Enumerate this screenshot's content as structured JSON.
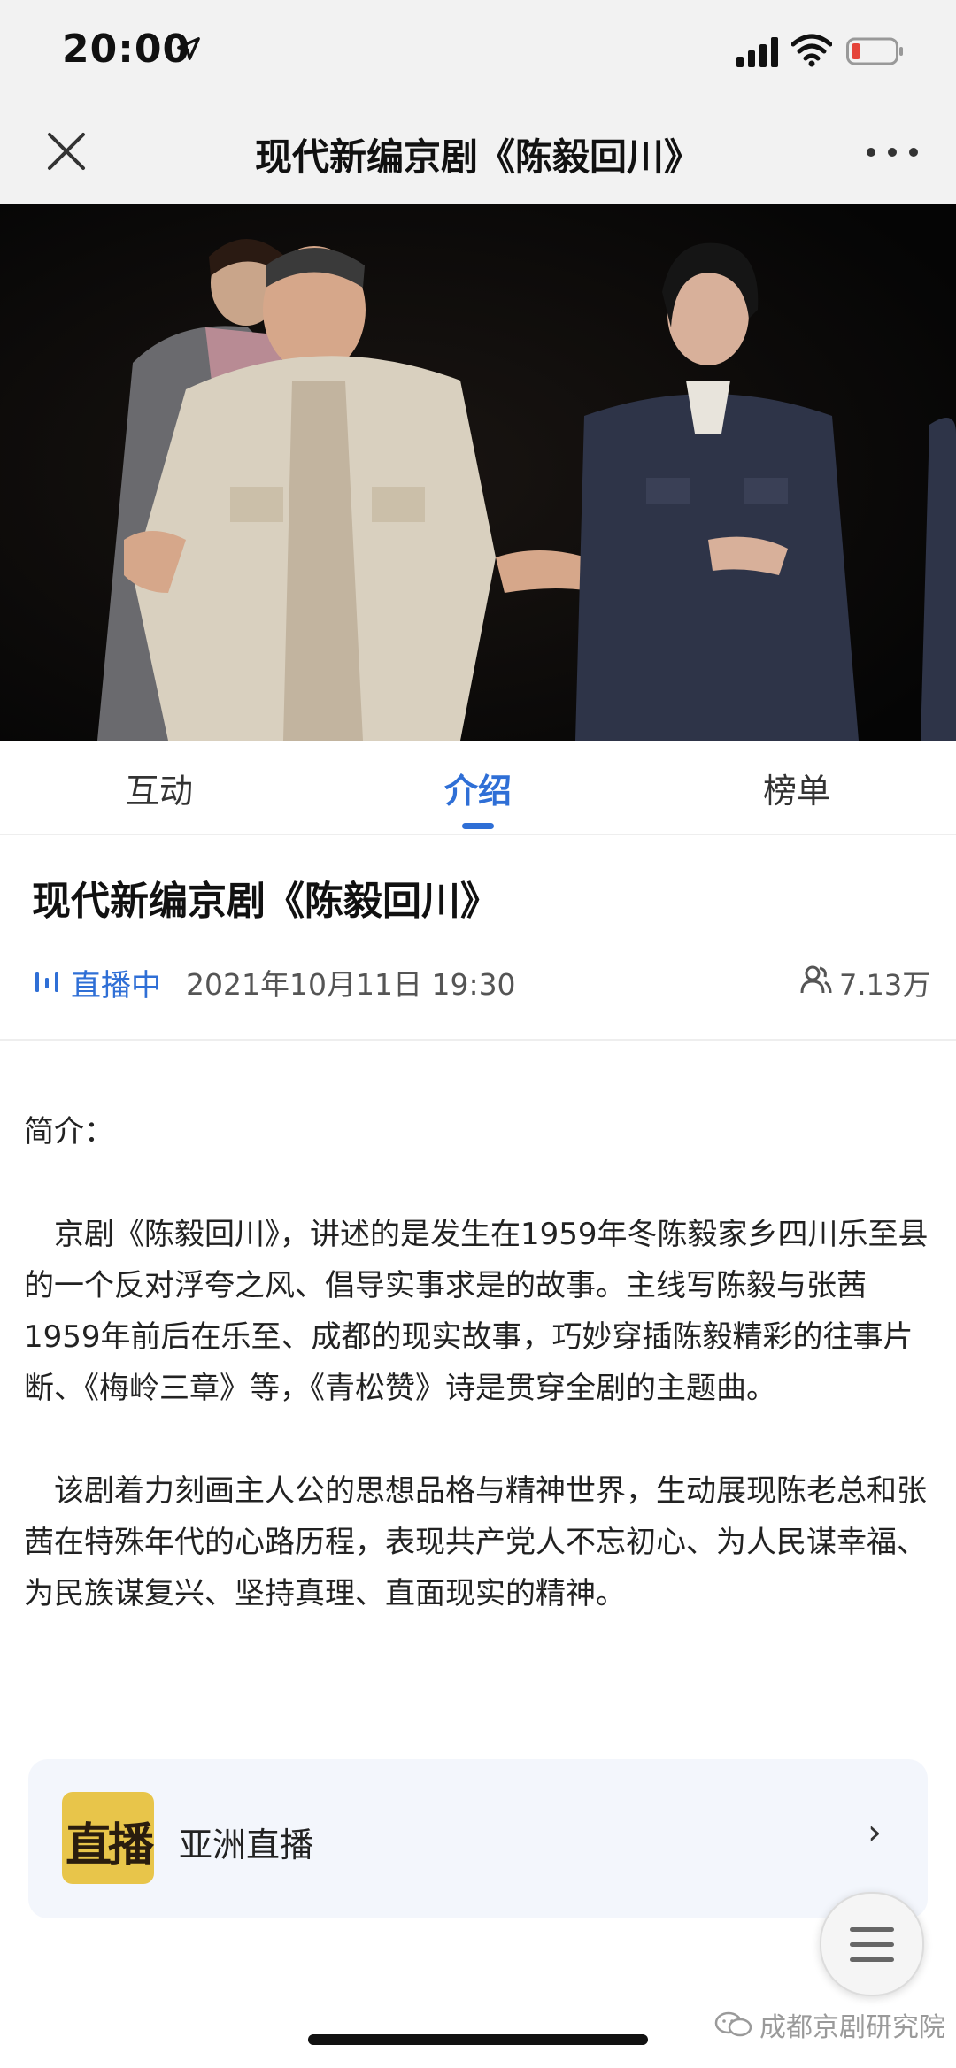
{
  "status_bar": {
    "time": "20:00"
  },
  "nav": {
    "title": "现代新编京剧《陈毅回川》"
  },
  "tabs": [
    {
      "label": "互动"
    },
    {
      "label": "介绍",
      "active": true
    },
    {
      "label": "榜单"
    }
  ],
  "program": {
    "title": "现代新编京剧《陈毅回川》",
    "live_status": "直播中",
    "datetime": "2021年10月11日 19:30",
    "viewers": "7.13万"
  },
  "intro": {
    "heading": "简介：",
    "paragraph1": "京剧《陈毅回川》，讲述的是发生在1959年冬陈毅家乡四川乐至县的一个反对浮夸之风、倡导实事求是的故事。主线写陈毅与张茜1959年前后在乐至、成都的现实故事，巧妙穿插陈毅精彩的往事片断、《梅岭三章》等，《青松赞》诗是贯穿全剧的主题曲。",
    "paragraph2": "该剧着力刻画主人公的思想品格与精神世界，生动展现陈老总和张茜在特殊年代的心路历程，表现共产党人不忘初心、为人民谋幸福、为民族谋复兴、坚持真理、直面现实的精神。"
  },
  "channel": {
    "logo_text": "直播",
    "name": "亚洲直播",
    "chevron": "›"
  },
  "watermark": {
    "text": "成都京剧研究院"
  },
  "colors": {
    "accent": "#2f6fd6",
    "header_bg": "#f2f2f2",
    "card_bg": "#f3f6fc",
    "logo_bg": "#e8c54a",
    "battery_low": "#e5443a"
  }
}
